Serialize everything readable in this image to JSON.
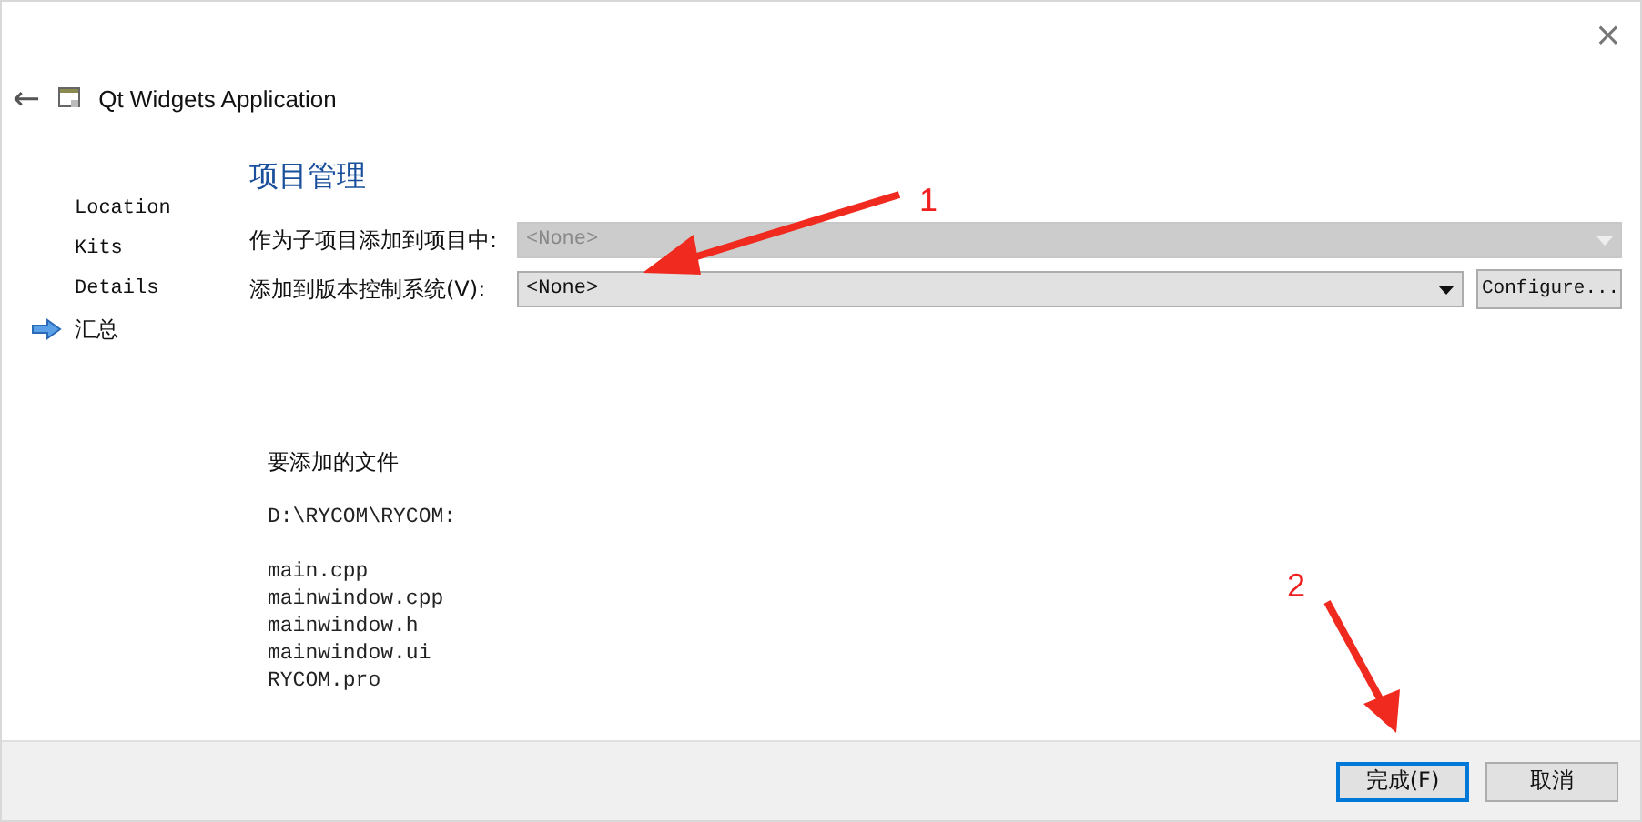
{
  "window": {
    "title": "Qt Widgets Application",
    "close": "×",
    "back": "←"
  },
  "sidebar": {
    "items": [
      {
        "label": "Location",
        "selected": false
      },
      {
        "label": "Kits",
        "selected": false
      },
      {
        "label": "Details",
        "selected": false
      },
      {
        "label": "汇总",
        "selected": true
      }
    ]
  },
  "section": {
    "title": "项目管理"
  },
  "fields": [
    {
      "label": "作为子项目添加到项目中:",
      "value": "<None>",
      "disabled": true
    },
    {
      "label": "添加到版本控制系统(V):",
      "value": "<None>",
      "disabled": false,
      "button": "Configure..."
    }
  ],
  "files": {
    "title": "要添加的文件",
    "path": "D:\\RYCOM\\RYCOM:",
    "items": [
      "main.cpp",
      "mainwindow.cpp",
      "mainwindow.h",
      "mainwindow.ui",
      "RYCOM.pro"
    ]
  },
  "buttons": [
    {
      "label": "完成(F)",
      "selected": true
    },
    {
      "label": "取消",
      "selected": false
    }
  ],
  "annotations": [
    {
      "label": "1"
    },
    {
      "label": "2"
    }
  ]
}
